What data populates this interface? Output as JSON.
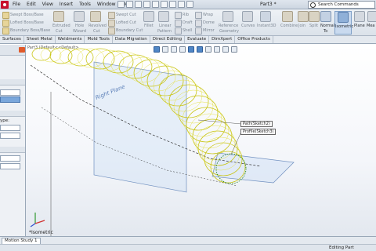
{
  "menubar": {
    "items": [
      "File",
      "Edit",
      "View",
      "Insert",
      "Tools",
      "Window",
      "Help"
    ],
    "doc_title": "Part3 *",
    "search_placeholder": "Search Commands"
  },
  "commands": {
    "swept_boss": "Swept Boss/Base",
    "lofted_boss": "Lofted Boss/Base",
    "boundary_boss": "Boundary Boss/Base",
    "extruded_cut_1": "Extruded",
    "extruded_cut_2": "Cut",
    "hole_wizard_1": "Hole",
    "hole_wizard_2": "Wizard",
    "revolved_cut_1": "Revolved",
    "revolved_cut_2": "Cut",
    "swept_cut": "Swept Cut",
    "lofted_cut": "Lofted Cut",
    "boundary_cut": "Boundary Cut",
    "fillet": "Fillet",
    "linear_pattern_1": "Linear",
    "linear_pattern_2": "Pattern",
    "rib": "Rib",
    "draft": "Draft",
    "shell": "Shell",
    "wrap": "Wrap",
    "dome": "Dome",
    "mirror": "Mirror",
    "ref_geom_1": "Reference",
    "ref_geom_2": "Geometry",
    "curves": "Curves",
    "instant3d": "Instant3D",
    "combine": "Combine",
    "join": "Join",
    "split": "Split",
    "normal_to_1": "Normal",
    "normal_to_2": "To",
    "isometric": "Isometric",
    "plane": "Plane",
    "measure": "Mea"
  },
  "tabs": [
    "Surfaces",
    "Sheet Metal",
    "Weldments",
    "Mold Tools",
    "Data Migration",
    "Direct Editing",
    "Evaluate",
    "DimXpert",
    "Office Products"
  ],
  "leftpanel": {
    "type_label": "ype:"
  },
  "graphics": {
    "tree_top": "Part3 (Default<<Default>",
    "plane_label": "Right Plane",
    "callout_path": "Path(Sketch2)",
    "callout_profile": "Profile(Sketch3)",
    "view_label": "*Isometric"
  },
  "motion_tab": "Motion Study 1",
  "status": "Editing Part"
}
